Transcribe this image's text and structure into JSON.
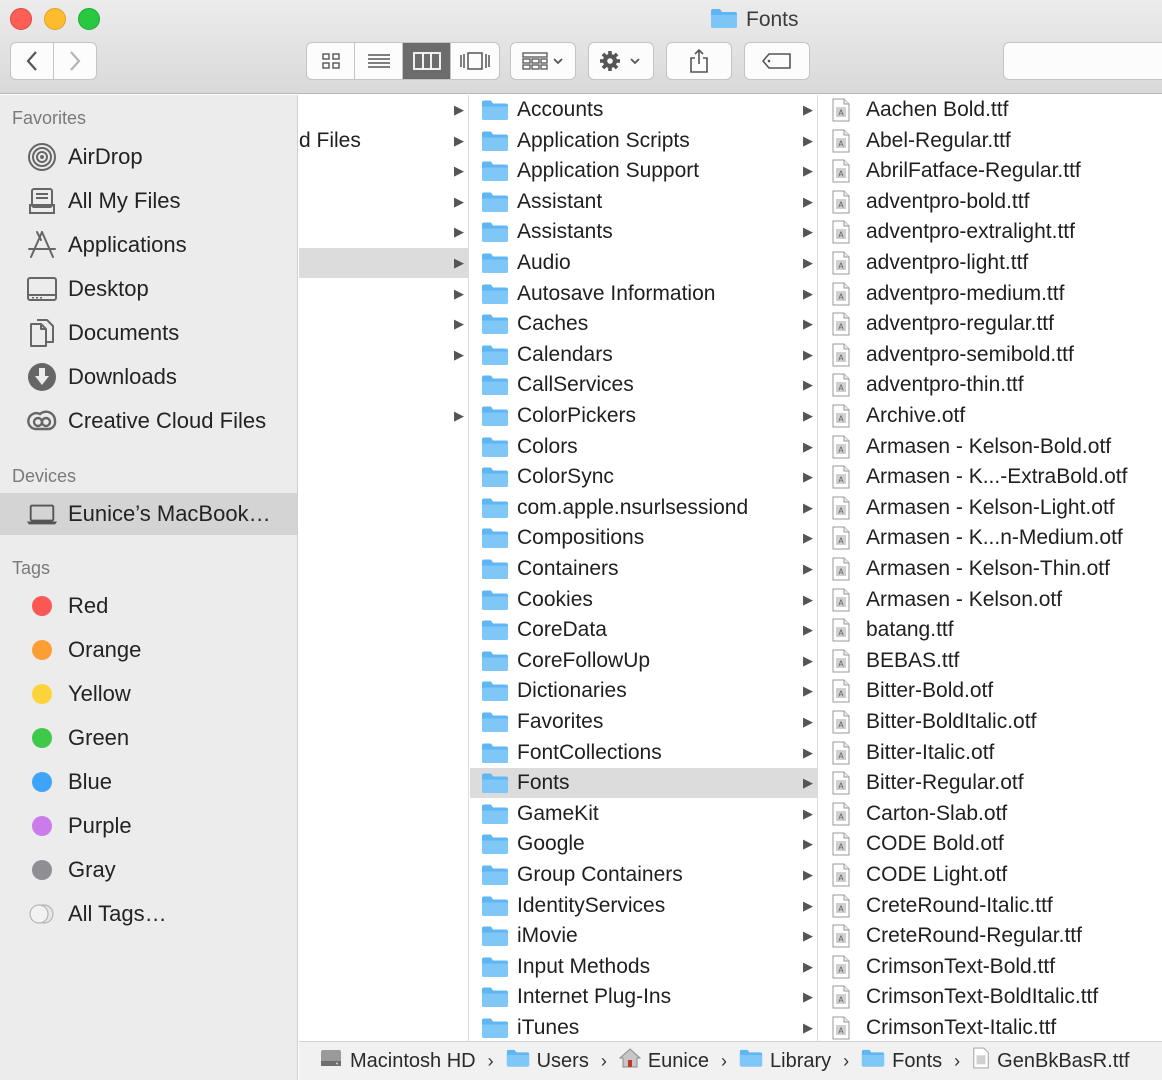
{
  "window": {
    "title": "Fonts"
  },
  "sidebar": {
    "favorites_header": "Favorites",
    "favorites": [
      {
        "label": "AirDrop",
        "icon": "airdrop-icon"
      },
      {
        "label": "All My Files",
        "icon": "all-my-files-icon"
      },
      {
        "label": "Applications",
        "icon": "applications-icon"
      },
      {
        "label": "Desktop",
        "icon": "desktop-icon"
      },
      {
        "label": "Documents",
        "icon": "documents-icon"
      },
      {
        "label": "Downloads",
        "icon": "downloads-icon"
      },
      {
        "label": "Creative Cloud Files",
        "icon": "creative-cloud-icon"
      }
    ],
    "devices_header": "Devices",
    "devices": [
      {
        "label": "Eunice’s MacBook…",
        "icon": "laptop-icon"
      }
    ],
    "tags_header": "Tags",
    "tags": [
      {
        "label": "Red",
        "color": "#fc5753"
      },
      {
        "label": "Orange",
        "color": "#fd9e35"
      },
      {
        "label": "Yellow",
        "color": "#fdd33a"
      },
      {
        "label": "Green",
        "color": "#3fc948"
      },
      {
        "label": "Blue",
        "color": "#3ea3fb"
      },
      {
        "label": "Purple",
        "color": "#cb7bea"
      },
      {
        "label": "Gray",
        "color": "#8e8e93"
      },
      {
        "label": "All Tags…",
        "color": "#d9d9d9"
      }
    ]
  },
  "column1": {
    "rows": [
      {
        "label": ""
      },
      {
        "label": "d Files"
      },
      {
        "label": ""
      },
      {
        "label": ""
      },
      {
        "label": ""
      },
      {
        "label": ""
      },
      {
        "label": ""
      },
      {
        "label": ""
      },
      {
        "label": ""
      },
      {
        "label": ""
      },
      {
        "label": ""
      }
    ]
  },
  "column2": {
    "items": [
      "Accounts",
      "Application Scripts",
      "Application Support",
      "Assistant",
      "Assistants",
      "Audio",
      "Autosave Information",
      "Caches",
      "Calendars",
      "CallServices",
      "ColorPickers",
      "Colors",
      "ColorSync",
      "com.apple.nsurlsessiond",
      "Compositions",
      "Containers",
      "Cookies",
      "CoreData",
      "CoreFollowUp",
      "Dictionaries",
      "Favorites",
      "FontCollections",
      "Fonts",
      "GameKit",
      "Google",
      "Group Containers",
      "IdentityServices",
      "iMovie",
      "Input Methods",
      "Internet Plug-Ins",
      "iTunes"
    ],
    "selected": "Fonts"
  },
  "column3": {
    "items": [
      "Aachen Bold.ttf",
      "Abel-Regular.ttf",
      "AbrilFatface-Regular.ttf",
      "adventpro-bold.ttf",
      "adventpro-extralight.ttf",
      "adventpro-light.ttf",
      "adventpro-medium.ttf",
      "adventpro-regular.ttf",
      "adventpro-semibold.ttf",
      "adventpro-thin.ttf",
      "Archive.otf",
      "Armasen - Kelson-Bold.otf",
      "Armasen - K...-ExtraBold.otf",
      "Armasen - Kelson-Light.otf",
      "Armasen - K...n-Medium.otf",
      "Armasen - Kelson-Thin.otf",
      "Armasen - Kelson.otf",
      "batang.ttf",
      "BEBAS.ttf",
      "Bitter-Bold.otf",
      "Bitter-BoldItalic.otf",
      "Bitter-Italic.otf",
      "Bitter-Regular.otf",
      "Carton-Slab.otf",
      "CODE Bold.otf",
      "CODE Light.otf",
      "CreteRound-Italic.ttf",
      "CreteRound-Regular.ttf",
      "CrimsonText-Bold.ttf",
      "CrimsonText-BoldItalic.ttf",
      "CrimsonText-Italic.ttf"
    ]
  },
  "pathbar": {
    "crumbs": [
      {
        "label": "Macintosh HD",
        "icon": "hard-drive-icon"
      },
      {
        "label": "Users",
        "icon": "folder-icon"
      },
      {
        "label": "Eunice",
        "icon": "home-icon"
      },
      {
        "label": "Library",
        "icon": "folder-icon"
      },
      {
        "label": "Fonts",
        "icon": "folder-icon"
      },
      {
        "label": "GenBkBasR.ttf",
        "icon": "font-file-icon"
      }
    ]
  },
  "colors": {
    "folder": "#5fb6f3",
    "selection": "#dcdcdc"
  }
}
